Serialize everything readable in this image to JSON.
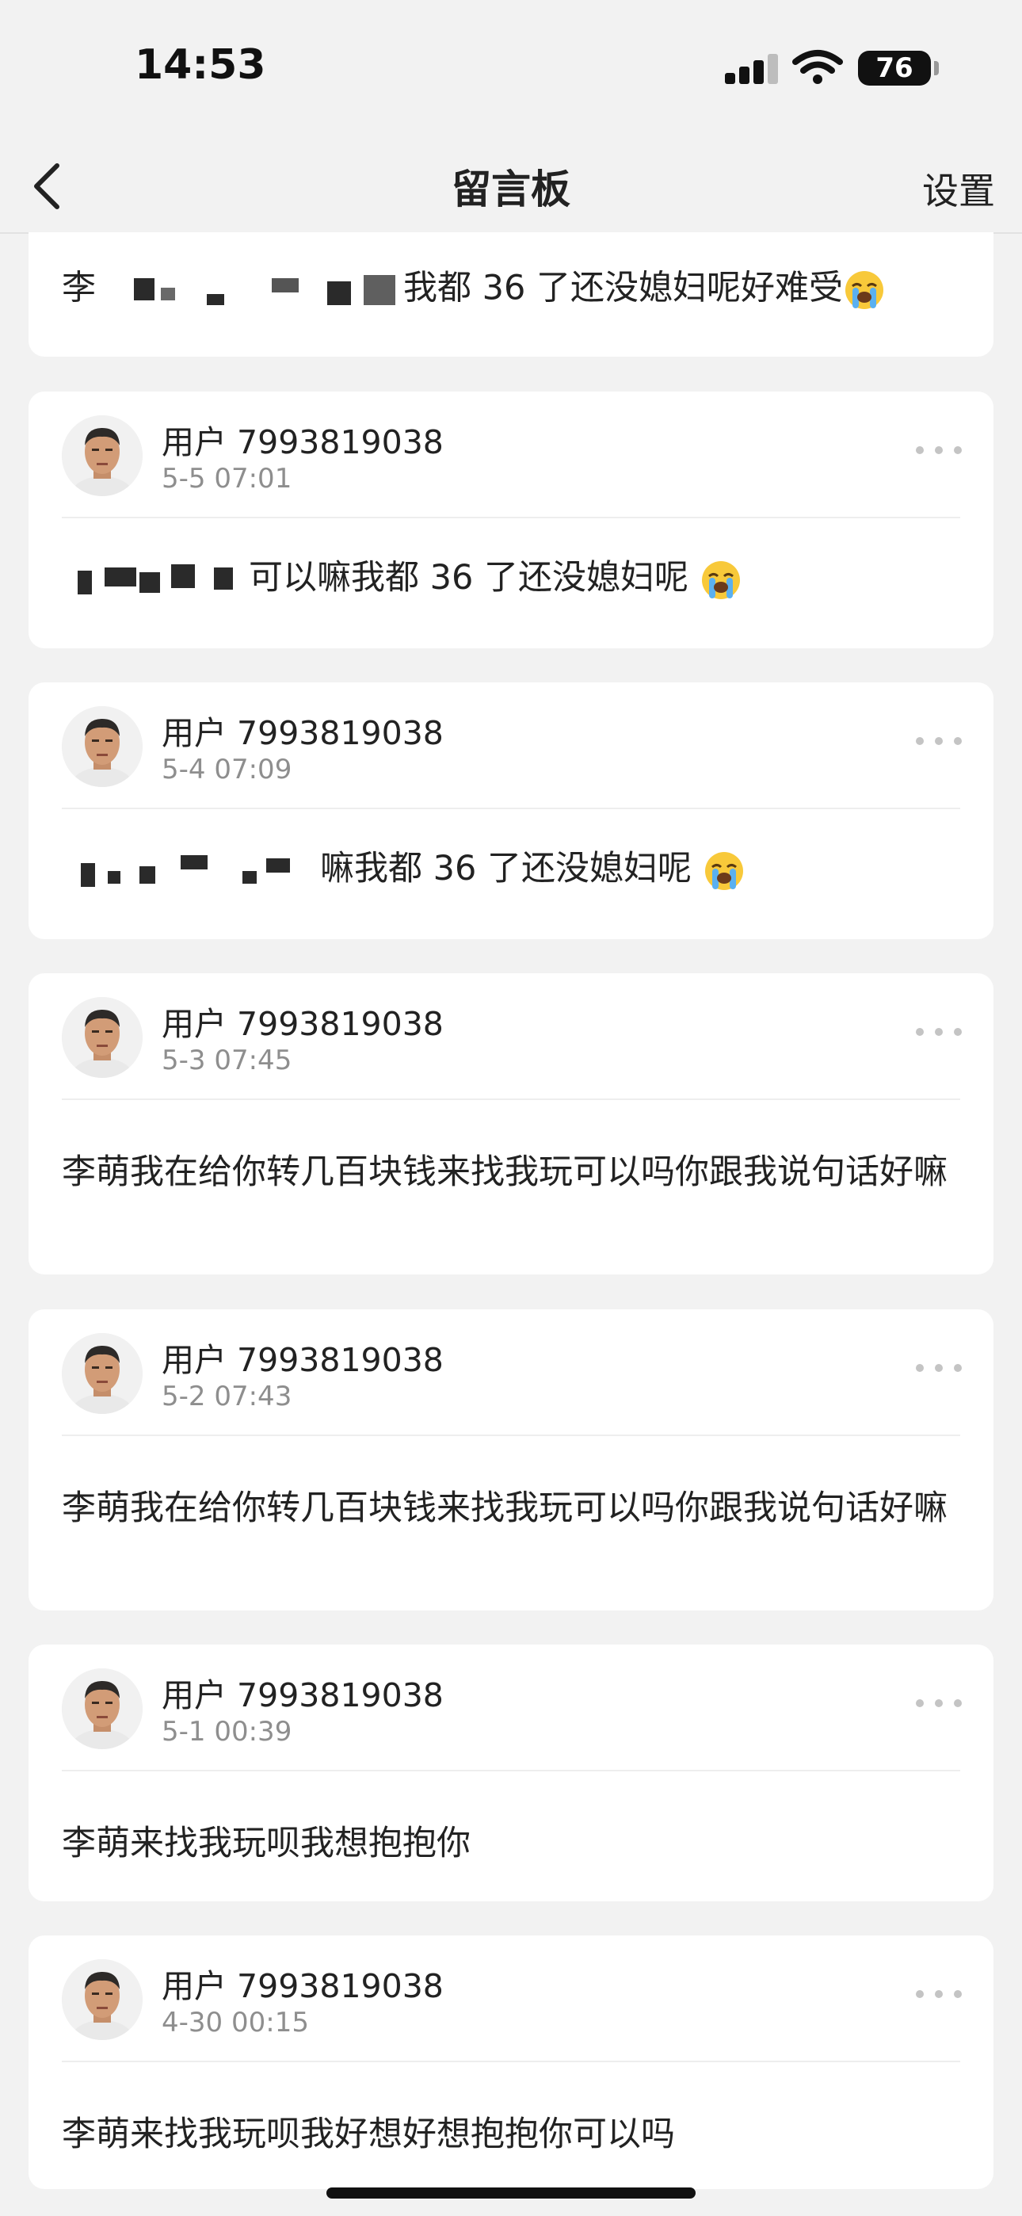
{
  "status_bar": {
    "time": "14:53",
    "battery": "76"
  },
  "nav": {
    "title": "留言板",
    "settings": "设置"
  },
  "colors": {
    "background": "#f2f2f2",
    "card": "#ffffff",
    "text": "#222222",
    "muted": "#8e8e8e"
  },
  "top_card": {
    "text_before": "李",
    "text_after": "我都 36 了还没媳妇呢好难受",
    "emoji": "loudly-crying-face"
  },
  "messages": [
    {
      "user": "用户 7993819038",
      "time": "5-5 07:01",
      "text_before": "",
      "text_after": "可以嘛我都 36 了还没媳妇呢",
      "emoji": "loudly-crying-face",
      "redacted": true
    },
    {
      "user": "用户 7993819038",
      "time": "5-4 07:09",
      "text_before": "",
      "text_after": "嘛我都 36 了还没媳妇呢",
      "emoji": "loudly-crying-face",
      "redacted": true
    },
    {
      "user": "用户 7993819038",
      "time": "5-3 07:45",
      "text": "李萌我在给你转几百块钱来找我玩可以吗你跟我说句话好嘛",
      "redacted": false
    },
    {
      "user": "用户 7993819038",
      "time": "5-2 07:43",
      "text": "李萌我在给你转几百块钱来找我玩可以吗你跟我说句话好嘛",
      "redacted": false
    },
    {
      "user": "用户 7993819038",
      "time": "5-1 00:39",
      "text": "李萌来找我玩呗我想抱抱你",
      "redacted": false
    },
    {
      "user": "用户 7993819038",
      "time": "4-30 00:15",
      "text": "李萌来找我玩呗我好想好想抱抱你可以吗",
      "redacted": false
    }
  ]
}
